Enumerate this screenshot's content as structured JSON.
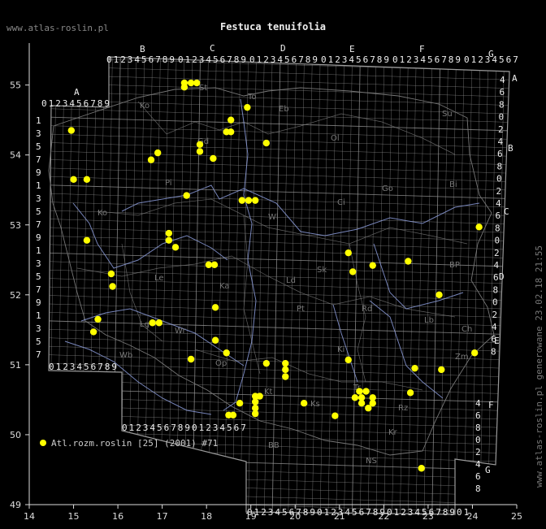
{
  "title": "Festuca tenuifolia",
  "site_url": "www.atlas-roslin.pl",
  "generated_note": "www.atlas-roslin.pl generowane 23.02.18 21:55",
  "legend_label": "Atl.rozm.roslin [25] (2001) #71",
  "colors": {
    "background": "#000000",
    "grid": "#9a9a9a",
    "axis": "#dddddd",
    "rivers": "#8b9bd9",
    "boundaries": "#777777",
    "points": "#ffff00"
  },
  "chart_data": {
    "type": "scatter",
    "x_ticks": [
      "14",
      "15",
      "16",
      "17",
      "18",
      "19",
      "20",
      "21",
      "22",
      "23",
      "24",
      "25"
    ],
    "y_ticks": [
      "49",
      "50",
      "51",
      "52",
      "53",
      "54",
      "55"
    ],
    "xlim": [
      14,
      25
    ],
    "ylim": [
      49,
      55.6
    ],
    "grid_columns": [
      "A",
      "B",
      "C",
      "D",
      "E",
      "F",
      "G"
    ],
    "grid_rows": [
      "A",
      "B",
      "C",
      "D",
      "E",
      "F",
      "G"
    ],
    "top_digits": "0123456789",
    "region_labels": [
      "Ko",
      "Eb",
      "Ol",
      "Su",
      "St",
      "Gd",
      "To",
      "Bi",
      "Pi",
      "Ci",
      "Go",
      "Ko",
      "Wl",
      "Sk",
      "Ld",
      "BP",
      "Le",
      "Ka",
      "Pt",
      "Rd",
      "Lb",
      "Ch",
      "Wr",
      "Ki",
      "Zm",
      "Lg",
      "Wb",
      "Op",
      "Kt",
      "Tr",
      "Rz",
      "Ks",
      "NS",
      "Kr",
      "BB"
    ],
    "points": [
      {
        "x": 14.95,
        "y": 54.35
      },
      {
        "x": 15.0,
        "y": 53.65
      },
      {
        "x": 15.3,
        "y": 53.65
      },
      {
        "x": 15.3,
        "y": 52.78
      },
      {
        "x": 15.45,
        "y": 51.47
      },
      {
        "x": 15.55,
        "y": 51.65
      },
      {
        "x": 15.85,
        "y": 52.3
      },
      {
        "x": 15.88,
        "y": 52.12
      },
      {
        "x": 16.75,
        "y": 53.93
      },
      {
        "x": 16.9,
        "y": 54.03
      },
      {
        "x": 16.78,
        "y": 51.6
      },
      {
        "x": 16.93,
        "y": 51.6
      },
      {
        "x": 17.15,
        "y": 52.88
      },
      {
        "x": 17.15,
        "y": 52.78
      },
      {
        "x": 17.3,
        "y": 52.68
      },
      {
        "x": 17.5,
        "y": 54.97
      },
      {
        "x": 17.5,
        "y": 55.03
      },
      {
        "x": 17.65,
        "y": 55.03
      },
      {
        "x": 17.78,
        "y": 55.03
      },
      {
        "x": 17.55,
        "y": 53.42
      },
      {
        "x": 17.65,
        "y": 51.08
      },
      {
        "x": 17.85,
        "y": 54.15
      },
      {
        "x": 17.85,
        "y": 54.05
      },
      {
        "x": 18.05,
        "y": 52.43
      },
      {
        "x": 18.15,
        "y": 53.95
      },
      {
        "x": 18.18,
        "y": 52.43
      },
      {
        "x": 18.2,
        "y": 51.35
      },
      {
        "x": 18.2,
        "y": 51.82
      },
      {
        "x": 18.45,
        "y": 54.33
      },
      {
        "x": 18.55,
        "y": 54.33
      },
      {
        "x": 18.55,
        "y": 54.5
      },
      {
        "x": 18.45,
        "y": 51.17
      },
      {
        "x": 18.5,
        "y": 50.28
      },
      {
        "x": 18.6,
        "y": 50.28
      },
      {
        "x": 18.8,
        "y": 53.35
      },
      {
        "x": 18.92,
        "y": 54.68
      },
      {
        "x": 18.95,
        "y": 53.35
      },
      {
        "x": 19.1,
        "y": 53.35
      },
      {
        "x": 18.75,
        "y": 50.45
      },
      {
        "x": 19.1,
        "y": 50.55
      },
      {
        "x": 19.1,
        "y": 50.47
      },
      {
        "x": 19.1,
        "y": 50.38
      },
      {
        "x": 19.1,
        "y": 50.3
      },
      {
        "x": 19.2,
        "y": 50.55
      },
      {
        "x": 19.35,
        "y": 54.17
      },
      {
        "x": 19.35,
        "y": 51.02
      },
      {
        "x": 19.78,
        "y": 51.02
      },
      {
        "x": 19.78,
        "y": 50.93
      },
      {
        "x": 19.78,
        "y": 50.83
      },
      {
        "x": 20.2,
        "y": 50.45
      },
      {
        "x": 20.9,
        "y": 50.27
      },
      {
        "x": 21.2,
        "y": 52.6
      },
      {
        "x": 21.2,
        "y": 51.07
      },
      {
        "x": 21.3,
        "y": 52.33
      },
      {
        "x": 21.35,
        "y": 50.53
      },
      {
        "x": 21.45,
        "y": 50.62
      },
      {
        "x": 21.5,
        "y": 50.53
      },
      {
        "x": 21.5,
        "y": 50.45
      },
      {
        "x": 21.6,
        "y": 50.62
      },
      {
        "x": 21.65,
        "y": 50.38
      },
      {
        "x": 21.75,
        "y": 50.53
      },
      {
        "x": 21.75,
        "y": 50.45
      },
      {
        "x": 21.75,
        "y": 52.42
      },
      {
        "x": 22.55,
        "y": 52.48
      },
      {
        "x": 22.6,
        "y": 50.6
      },
      {
        "x": 22.7,
        "y": 50.95
      },
      {
        "x": 22.85,
        "y": 49.52
      },
      {
        "x": 23.25,
        "y": 52.0
      },
      {
        "x": 23.3,
        "y": 50.93
      },
      {
        "x": 24.05,
        "y": 51.17
      },
      {
        "x": 24.15,
        "y": 52.97
      }
    ]
  }
}
